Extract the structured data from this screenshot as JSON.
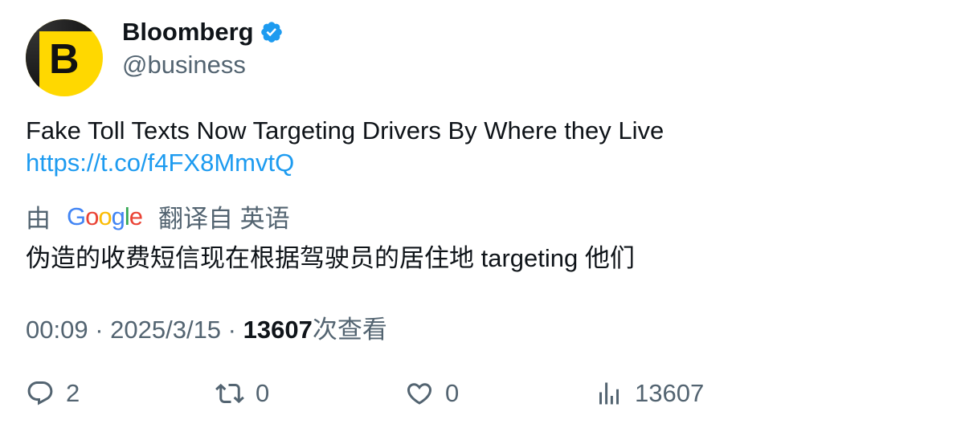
{
  "author": {
    "avatar_letter": "B",
    "display_name": "Bloomberg",
    "handle": "@business",
    "verified_icon": "verified-badge-icon",
    "verified_color": "#1d9bf0"
  },
  "tweet": {
    "text": "Fake Toll Texts Now Targeting Drivers By Where they Live",
    "link": "https://t.co/f4FX8MmvtQ"
  },
  "translation": {
    "prefix": "由",
    "provider": "Google",
    "suffix": "翻译自 英语",
    "text": "伪造的收费短信现在根据驾驶员的居住地 targeting 他们"
  },
  "meta": {
    "time": "00:09",
    "separator": " · ",
    "date": "2025/3/15",
    "views_count": "13607",
    "views_label": "次查看"
  },
  "actions": {
    "replies": "2",
    "retweets": "0",
    "likes": "0",
    "views": "13607"
  },
  "colors": {
    "link": "#1d9bf0",
    "secondary_text": "#536471",
    "primary_text": "#0f1419",
    "avatar_bg": "#ffd800"
  }
}
